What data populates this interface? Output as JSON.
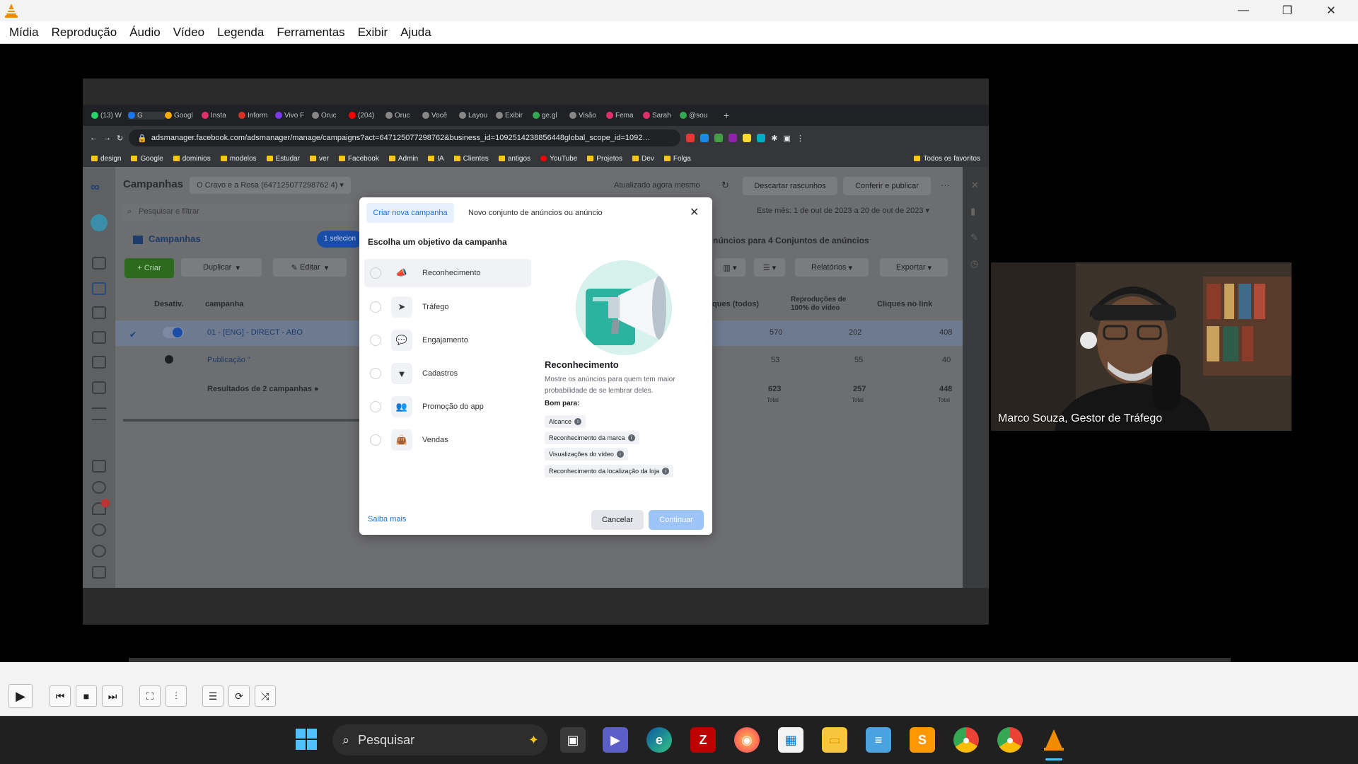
{
  "vlc": {
    "menu": [
      "Mídia",
      "Reprodução",
      "Áudio",
      "Vídeo",
      "Legenda",
      "Ferramentas",
      "Exibir",
      "Ajuda"
    ],
    "window_buttons": {
      "minimize": "—",
      "restore": "❐",
      "close": "✕"
    }
  },
  "browser": {
    "tabs": [
      "(13) W",
      "G",
      "Googl",
      "Insta",
      "Inform",
      "Vivo F",
      "Oruc",
      "(204)",
      "Oruc",
      "Você",
      "Layou",
      "Exibir",
      "ge.gl",
      "Visão",
      "Fema",
      "Sarah",
      "@sou"
    ],
    "url": "adsmanager.facebook.com/adsmanager/manage/campaigns?act=647125077298762&business_id=1092514238856448global_scope_id=1092…",
    "bookmarks": [
      "design",
      "Google",
      "dominios",
      "modelos",
      "Estudar",
      "ver",
      "Facebook",
      "Admin",
      "IA",
      "Clientes",
      "antigos",
      "YouTube",
      "Projetos",
      "Dev",
      "Folga"
    ],
    "bookmarks_right": "Todos os favoritos"
  },
  "ads": {
    "title": "Campanhas",
    "account": "O Cravo e a Rosa (647125077298762 4)",
    "updated": "Atualizado agora mesmo",
    "discard": "Descartar rascunhos",
    "review": "Conferir e publicar",
    "search_placeholder": "Pesquisar e filtrar",
    "date_range": "Este mês: 1 de out de 2023 a 20 de out de 2023",
    "tab_campanhas": "Campanhas",
    "selected": "1 selecion",
    "ads_for": "núncios para 4 Conjuntos de anúncios",
    "create": "+ Criar",
    "duplicate": "Duplicar",
    "edit": "Editar",
    "reports": "Relatórios",
    "export": "Exportar",
    "col_off": "Desativ.",
    "col_campaign": "campanha",
    "col_clicks_all": "iques (todos)",
    "col_views": "Reproduções de 100% do vídeo",
    "col_link_clicks": "Cliques no link",
    "rows": [
      {
        "name": "01 - [ENG] - DIRECT - ABO",
        "c1": "570",
        "c2": "202",
        "c3": "408"
      },
      {
        "name": "Publicação \"",
        "c1": "53",
        "c2": "55",
        "c3": "40"
      }
    ],
    "totals": {
      "label": "Resultados de 2 campanhas",
      "c1": "623",
      "c2": "257",
      "c3": "448",
      "sub": "Total"
    }
  },
  "dialog": {
    "tab_new": "Criar nova campanha",
    "tab_set": "Novo conjunto de anúncios ou anúncio",
    "heading": "Escolha um objetivo da campanha",
    "objectives": [
      {
        "label": "Reconhecimento",
        "icon": "megaphone-icon",
        "glyph": "📣"
      },
      {
        "label": "Tráfego",
        "icon": "cursor-icon",
        "glyph": "➤"
      },
      {
        "label": "Engajamento",
        "icon": "chat-icon",
        "glyph": "💬"
      },
      {
        "label": "Cadastros",
        "icon": "funnel-icon",
        "glyph": "▼"
      },
      {
        "label": "Promoção do app",
        "icon": "people-icon",
        "glyph": "👥"
      },
      {
        "label": "Vendas",
        "icon": "bag-icon",
        "glyph": "👜"
      }
    ],
    "selected_title": "Reconhecimento",
    "selected_desc": "Mostre os anúncios para quem tem maior probabilidade de se lembrar deles.",
    "good_for": "Bom para:",
    "chips": [
      "Alcance",
      "Reconhecimento da marca",
      "Visualizações do vídeo",
      "Reconhecimento da localização da loja"
    ],
    "learn_more": "Saiba mais",
    "cancel": "Cancelar",
    "continue": "Continuar"
  },
  "webcam": {
    "name": "Marco Souza, Gestor de Tráfego"
  },
  "taskbar": {
    "search": "Pesquisar"
  },
  "colors": {
    "accent": "#1a73e8",
    "create_green": "#42b72a",
    "vlc_orange": "#f08c00"
  }
}
